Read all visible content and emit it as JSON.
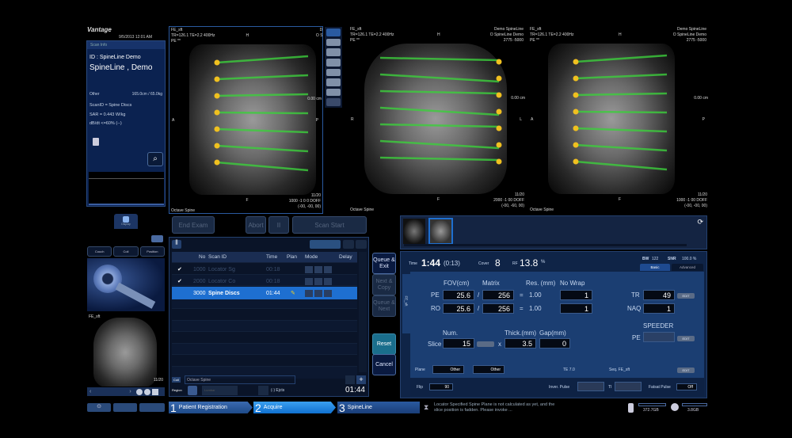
{
  "app": {
    "name": "Vantage",
    "datetime": "9/5/2013 12:01 AM"
  },
  "scan_info": {
    "header": "Scan Info",
    "id_line": "ID : SpineLine Demo",
    "name": "SpineLine , Demo",
    "other_label": "Other",
    "other_value": "165.0cm / 65.0kg",
    "scan_id": "ScanID = Spine Discs",
    "sar": "SAR = 0.443 W/kg",
    "dbdt": "dB/dt <=60% (--)"
  },
  "viewports": [
    {
      "seq": "FE_sft",
      "params": "TR=126.1 TE=2.2 400Hz",
      "pe": "PE **",
      "top": "H",
      "bottom": "F",
      "left": "A",
      "right": "P",
      "site": "Demo",
      "site2": "O Spine",
      "slice": "11/20",
      "wl": "1000 -1 0 0 DOFF",
      "coords": "(-00, -00, 00)",
      "series_name": "Octave Spine",
      "scale": "0.00 cm"
    },
    {
      "seq": "FE_sft",
      "params": "TR=126.1 TE=2.2 400Hz",
      "pe": "PE **",
      "top": "H",
      "bottom": "F",
      "left": "R",
      "right": "L",
      "site": "Demo SpineLine",
      "site2": "O SpineLine Demo",
      "range": "2775 -5000",
      "slice": "11/20",
      "wl": "2000 -1 00 DOFF",
      "coords": "(-00, -60, 00)",
      "series_name": "Octave Spine",
      "scale": "0.00 cm"
    },
    {
      "seq": "FE_sft",
      "params": "TR=126.1 TE=2.2 400Hz",
      "pe": "PE **",
      "top": "H",
      "bottom": "F",
      "left": "A",
      "right": "P",
      "site": "Demo SpineLine",
      "site2": "O SpineLine Demo",
      "range": "2775 -5000",
      "slice": "11/20",
      "wl": "1000 -1 00 DOFF",
      "coords": "(-00, -00, 00)",
      "series_name": "Octave Spine",
      "scale": "0.00 cm"
    }
  ],
  "left_bottom": {
    "view_btn": "Display",
    "tabs": [
      "Couch",
      "Coil",
      "Position"
    ],
    "thumb_label": "FE_sft",
    "thumb_slice": "11/20"
  },
  "controls": {
    "end_exam": "End Exam",
    "abort": "Abort",
    "pause": "II",
    "scan_start": "Scan Start"
  },
  "queue": {
    "columns": [
      "No",
      "Scan ID",
      "Time",
      "Plan",
      "Mode",
      "Delay"
    ],
    "rows": [
      {
        "check": "✔",
        "no": "1000",
        "id": "Locator Sg",
        "time": "00:18",
        "plan": "",
        "state": "done"
      },
      {
        "check": "✔",
        "no": "2000",
        "id": "Locator Co",
        "time": "00:18",
        "plan": "",
        "state": "done"
      },
      {
        "check": "",
        "no": "3000",
        "id": "Spine Discs",
        "time": "01:44",
        "plan": "✎",
        "state": "selected"
      }
    ],
    "coil_label": "Coil",
    "coil_value": "Octave Spine",
    "region_label": "Region",
    "region_value": "Lumbar",
    "ejects": "(-) Ejcts",
    "total_time": "01:44"
  },
  "side_buttons": {
    "queue_exit": "Queue & Exit",
    "next_copy": "Next & Copy",
    "queue_next": "Queue & Next",
    "reset": "Reset",
    "cancel": "Cancel"
  },
  "params": {
    "time_label": "Time",
    "time": "1:44",
    "time_sub": "(0:13)",
    "cover_label": "Cover",
    "cover": "8",
    "rf_label": "RF",
    "rf": "13.8",
    "rf_unit": "%",
    "bw_label": "BW",
    "bw": "122",
    "snr_label": "SNR",
    "snr": "100.0 %",
    "tabs": [
      "Basic",
      "Advanced"
    ],
    "side_tab": "FE_sft",
    "fov_label": "FOV(cm)",
    "matrix_label": "Matrix",
    "res_label": "Res. (mm)",
    "nowrap_label": "No Wrap",
    "pe_label": "PE",
    "ro_label": "RO",
    "pe_fov": "25.6",
    "pe_matrix": "256",
    "pe_res": "1.00",
    "pe_nowrap": "1",
    "ro_fov": "25.6",
    "ro_matrix": "256",
    "ro_res": "1.00",
    "ro_nowrap": "1",
    "tr_label": "TR",
    "tr": "49",
    "naq_label": "NAQ",
    "naq": "1",
    "num_label": "Num.",
    "slice_label": "Slice",
    "slice": "15",
    "thick_label": "Thick.(mm)",
    "thick": "3.5",
    "gap_label": "Gap(mm)",
    "gap": "0",
    "speeder_label": "SPEEDER",
    "speeder_pe_label": "PE",
    "speeder_pe": "",
    "plane_label": "Plane",
    "plane1": "Other",
    "plane2": "Other",
    "te": "TE 7.0",
    "seq": "Seq. FE_sft",
    "flip_label": "Flip",
    "flip": "90",
    "inver_label": "Inver. Pulse",
    "ti_label": "TI",
    "fatsat_label": "Fatsat Pulse",
    "fatsat": "Off",
    "edit": "EDIT"
  },
  "footer": {
    "steps": [
      {
        "num": "1",
        "label": "Patient Registration"
      },
      {
        "num": "2",
        "label": "Acquire"
      },
      {
        "num": "3",
        "label": "SpineLine"
      }
    ],
    "message": "Locator Specified Spine Plane is not calculated as yet, and the slice position is fadden. Please invoke ...",
    "disk1": "372.7GB",
    "disk2": "3.8GB"
  },
  "colors": {
    "panel": "#0d2148",
    "accent": "#1e6fd0",
    "reset": "#1a6e8c",
    "overlay_green": "#3ccf3c",
    "overlay_yellow": "#f0c020"
  }
}
